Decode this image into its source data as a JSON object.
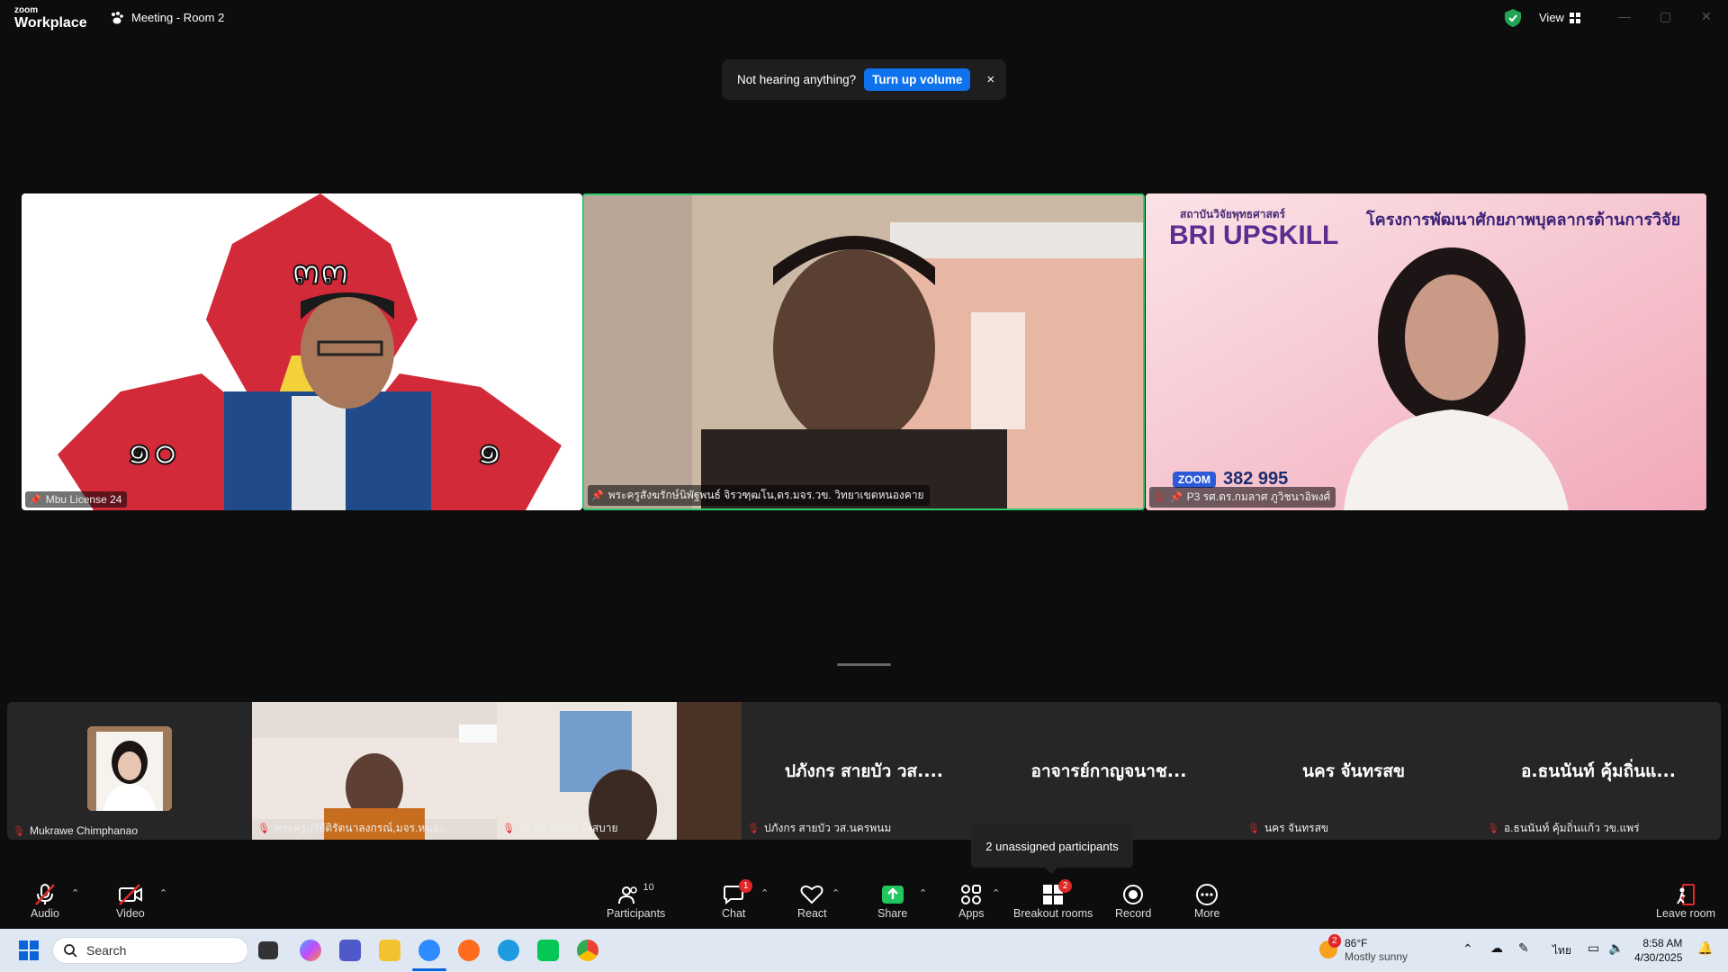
{
  "app": {
    "logo_top": "zoom",
    "logo_bottom": "Workplace",
    "meeting_title": "Meeting - Room 2",
    "view_label": "View"
  },
  "notice": {
    "text": "Not hearing anything?",
    "button": "Turn up volume",
    "close": "×"
  },
  "main_tiles": [
    {
      "name": "Mbu License 24"
    },
    {
      "name": "พระครูสังฆรักษ์นิพัฐพนธ์  จิรวฑฺฒโน,ดร.มจร.วข. วิทยาเขตหนองคาย"
    },
    {
      "name": "P3 รศ.ดร.กมลาศ ภูวิชนาอิพงศ์"
    }
  ],
  "slide": {
    "org": "สถาบันวิจัยพุทธศาสตร์",
    "brand": "BRI UPSKILL",
    "headline": "โครงการพัฒนาศักยภาพบุคลากรด้านการวิจัย",
    "zoom_tag": "ZOOM",
    "zoom_number": "382 995"
  },
  "logo_numerals": {
    "top": "๓๓",
    "left": "๑๐",
    "right": "๑"
  },
  "strip": [
    {
      "label": "Mukrawe Chimphanao",
      "big": ""
    },
    {
      "label": "พระครูปริยัติรัตนาลงกรณ์,มจร.หนอง...",
      "big": ""
    },
    {
      "label": "29 ดร.สดพล ใจสบาย",
      "big": ""
    },
    {
      "label": "ปภังกร สายบัว วส.นครพนม",
      "big": "ปภังกร สายบัว วส...."
    },
    {
      "label": "",
      "big": "อาจารย์กาญจนาช..."
    },
    {
      "label": "นคร จันทรสข",
      "big": "นคร จันทรสข"
    },
    {
      "label": "อ.ธนนันท์ คุ้มถิ่นแก้ว วข.แพร่",
      "big": "อ.ธนนันท์ คุ้มถิ่นแ..."
    }
  ],
  "tooltip": "2 unassigned participants",
  "toolbar": {
    "audio": "Audio",
    "video": "Video",
    "participants": "Participants",
    "participants_count": "10",
    "chat": "Chat",
    "chat_badge": "1",
    "react": "React",
    "share": "Share",
    "apps": "Apps",
    "breakout": "Breakout rooms",
    "breakout_badge": "2",
    "record": "Record",
    "more": "More",
    "leave": "Leave room"
  },
  "taskbar": {
    "search": "Search",
    "weather_badge": "2",
    "temp": "86°F",
    "weather": "Mostly sunny",
    "lang": "ไทย",
    "time": "8:58 AM",
    "date": "4/30/2025"
  }
}
